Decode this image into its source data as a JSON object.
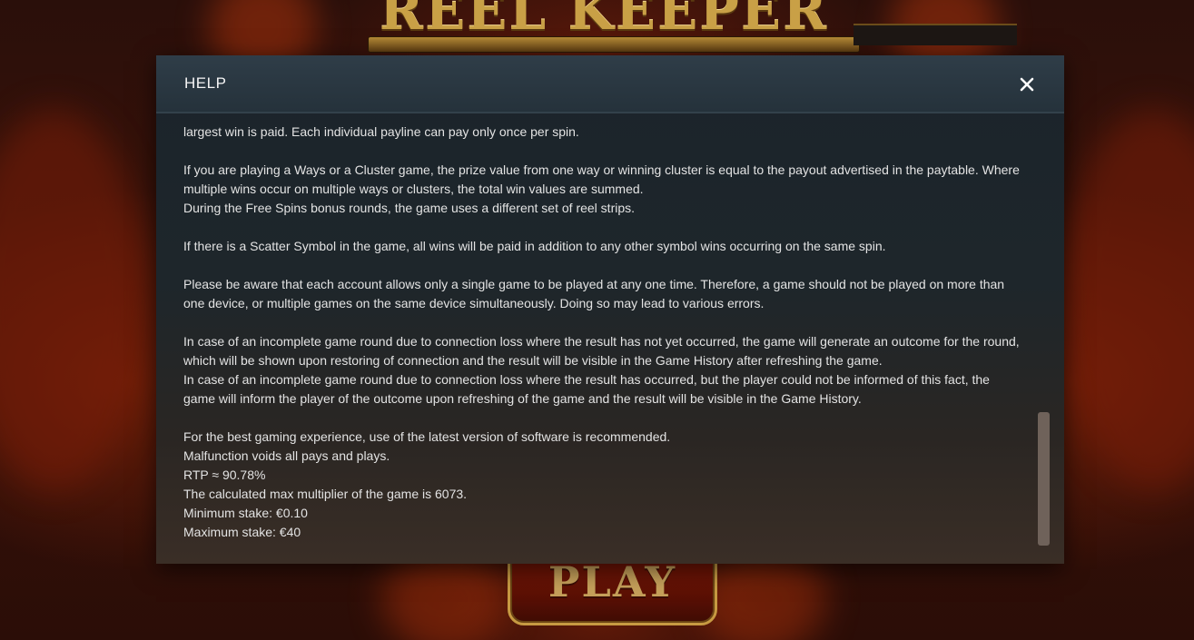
{
  "background": {
    "logo_text": "REEL KEEPER",
    "play_label": "PLAY"
  },
  "modal": {
    "title": "HELP",
    "close_icon": "close-icon",
    "paragraphs": [
      [
        "largest win is paid. Each individual payline can pay only once per spin."
      ],
      [
        "If you are playing a Ways or a Cluster game, the prize value from one way or winning cluster is equal to the payout advertised in the paytable. Where",
        "multiple wins occur on multiple ways or clusters, the total win values are summed.",
        "During the Free Spins bonus rounds, the game uses a different set of reel strips."
      ],
      [
        "If there is a Scatter Symbol in the game, all wins will be paid in addition to any other symbol wins occurring on the same spin."
      ],
      [
        "Please be aware that each account allows only a single game to be played at any one time. Therefore, a game should not be played on more than",
        "one device, or multiple games on the same device simultaneously. Doing so may lead to various errors."
      ],
      [
        "In case of an incomplete game round due to connection loss where the result has not yet occurred, the game will generate an outcome for the round,",
        "which will be shown upon restoring of connection and the result will be visible in the Game History after refreshing the game.",
        "In case of an incomplete game round due to connection loss where the result has occurred, but the player could not be informed of this fact, the",
        "game will inform the player of the outcome upon refreshing of the game and the result will be visible in the Game History."
      ],
      [
        "For the best gaming experience, use of the latest version of software is recommended.",
        "Malfunction voids all pays and plays.",
        "RTP ≈ 90.78%",
        "The calculated max multiplier of the game is 6073.",
        "Minimum stake: €0.10",
        "Maximum stake: €40"
      ]
    ]
  }
}
